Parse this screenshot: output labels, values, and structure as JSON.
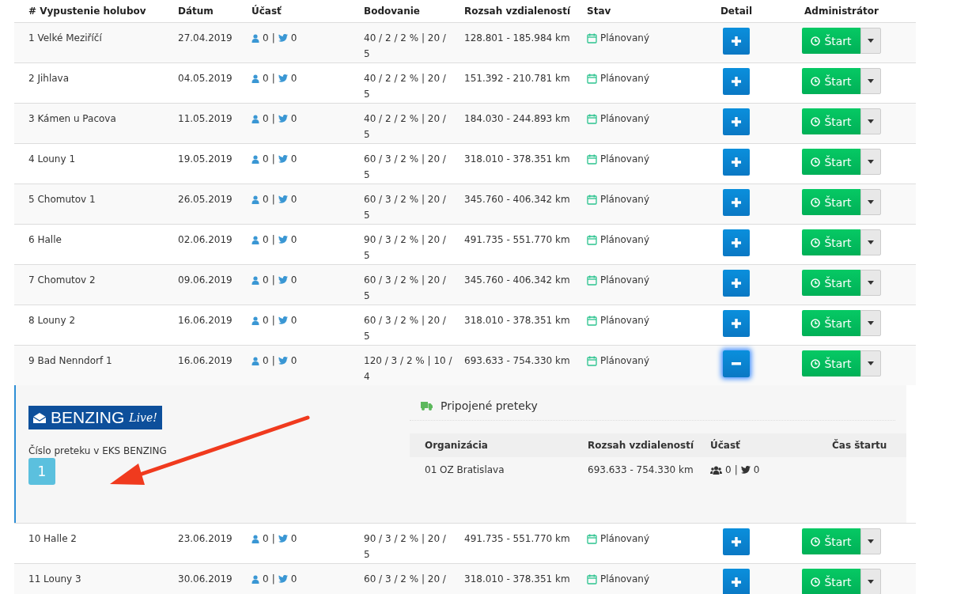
{
  "table": {
    "columns": [
      "# Vypustenie holubov",
      "Dátum",
      "Účasť",
      "Bodovanie",
      "Rozsah vzdialeností",
      "Stav",
      "Detail",
      "Administrátor"
    ],
    "rows": [
      {
        "name": "1 Velké Meziříčí",
        "date": "27.04.2019",
        "members": "0",
        "sep": "|",
        "tweets": "0",
        "scoring": "40 / 2 / 2 % | 20 / 5",
        "range": "128.801 - 185.984 km",
        "status": "Plánovaný",
        "expanded": false,
        "action": "Štart"
      },
      {
        "name": "2 Jihlava",
        "date": "04.05.2019",
        "members": "0",
        "sep": "|",
        "tweets": "0",
        "scoring": "40 / 2 / 2 % | 20 / 5",
        "range": "151.392 - 210.781 km",
        "status": "Plánovaný",
        "expanded": false,
        "action": "Štart"
      },
      {
        "name": "3 Kámen u Pacova",
        "date": "11.05.2019",
        "members": "0",
        "sep": "|",
        "tweets": "0",
        "scoring": "40 / 2 / 2 % | 20 / 5",
        "range": "184.030 - 244.893 km",
        "status": "Plánovaný",
        "expanded": false,
        "action": "Štart"
      },
      {
        "name": "4 Louny 1",
        "date": "19.05.2019",
        "members": "0",
        "sep": "|",
        "tweets": "0",
        "scoring": "60 / 3 / 2 % | 20 / 5",
        "range": "318.010 - 378.351 km",
        "status": "Plánovaný",
        "expanded": false,
        "action": "Štart"
      },
      {
        "name": "5 Chomutov 1",
        "date": "26.05.2019",
        "members": "0",
        "sep": "|",
        "tweets": "0",
        "scoring": "60 / 3 / 2 % | 20 / 5",
        "range": "345.760 - 406.342 km",
        "status": "Plánovaný",
        "expanded": false,
        "action": "Štart"
      },
      {
        "name": "6 Halle",
        "date": "02.06.2019",
        "members": "0",
        "sep": "|",
        "tweets": "0",
        "scoring": "90 / 3 / 2 % | 20 / 5",
        "range": "491.735 - 551.770 km",
        "status": "Plánovaný",
        "expanded": false,
        "action": "Štart"
      },
      {
        "name": "7 Chomutov 2",
        "date": "09.06.2019",
        "members": "0",
        "sep": "|",
        "tweets": "0",
        "scoring": "60 / 3 / 2 % | 20 / 5",
        "range": "345.760 - 406.342 km",
        "status": "Plánovaný",
        "expanded": false,
        "action": "Štart"
      },
      {
        "name": "8 Louny 2",
        "date": "16.06.2019",
        "members": "0",
        "sep": "|",
        "tweets": "0",
        "scoring": "60 / 3 / 2 % | 20 / 5",
        "range": "318.010 - 378.351 km",
        "status": "Plánovaný",
        "expanded": false,
        "action": "Štart"
      },
      {
        "name": "9 Bad Nenndorf 1",
        "date": "16.06.2019",
        "members": "0",
        "sep": "|",
        "tweets": "0",
        "scoring": "120 / 3 / 2 % | 10 / 4",
        "range": "693.633 - 754.330 km",
        "status": "Plánovaný",
        "expanded": true,
        "action": "Štart",
        "detail": {
          "logo_text": "BENZING",
          "logo_script": "Live!",
          "eks_label": "Číslo preteku v EKS BENZING",
          "eks_number": "1",
          "linked_title": "Pripojené preteky",
          "linked_columns": [
            "Organizácia",
            "Rozsah vzdialeností",
            "Účasť",
            "Čas štartu"
          ],
          "linked_rows": [
            {
              "organization": "01 OZ Bratislava",
              "range": "693.633 - 754.330 km",
              "members": "0",
              "sep": "|",
              "tweets": "0"
            }
          ]
        }
      },
      {
        "name": "10 Halle 2",
        "date": "23.06.2019",
        "members": "0",
        "sep": "|",
        "tweets": "0",
        "scoring": "90 / 3 / 2 % | 20 / 5",
        "range": "491.735 - 551.770 km",
        "status": "Plánovaný",
        "expanded": false,
        "action": "Štart"
      },
      {
        "name": "11 Louny 3",
        "date": "30.06.2019",
        "members": "0",
        "sep": "|",
        "tweets": "0",
        "scoring": "60 / 3 / 2 % | 20 /",
        "range": "318.010 - 378.351 km",
        "status": "Plánovaný",
        "expanded": false,
        "action": "Štart"
      }
    ]
  }
}
